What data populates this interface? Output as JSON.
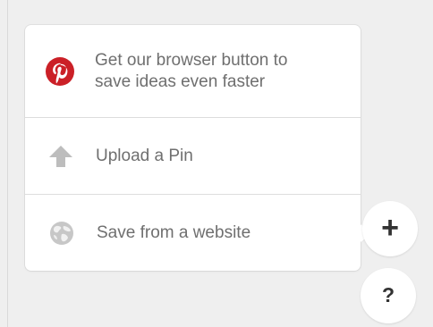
{
  "menu": {
    "items": [
      {
        "label_line_1": "Get our browser button to",
        "label_line_2": "save ideas even faster",
        "icon": "pinterest-logo-icon",
        "icon_color": "#CB2027"
      },
      {
        "label": "Upload a Pin",
        "icon": "upload-arrow-icon",
        "icon_color": "#BDBDBD"
      },
      {
        "label": "Save from a website",
        "icon": "globe-icon",
        "icon_color": "#C7C7C7"
      }
    ]
  },
  "floating_actions": {
    "add_label": "+",
    "help_label": "?"
  },
  "colors": {
    "background": "#EFEFEF",
    "panel": "#FFFFFF",
    "text": "#6F6F6F",
    "divider": "#DDDDDD",
    "button_text": "#333333"
  }
}
